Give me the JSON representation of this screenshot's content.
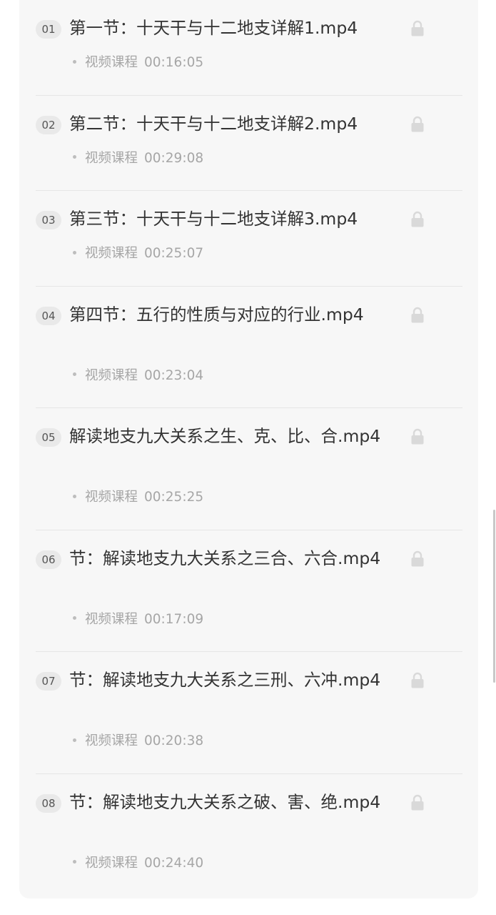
{
  "lessons": [
    {
      "index": "01",
      "title": "第一节：十天干与十二地支详解1.mp4",
      "type": "视频课程",
      "duration": "00:16:05",
      "locked": true
    },
    {
      "index": "02",
      "title": "第二节：十天干与十二地支详解2.mp4",
      "type": "视频课程",
      "duration": "00:29:08",
      "locked": true
    },
    {
      "index": "03",
      "title": "第三节：十天干与十二地支详解3.mp4",
      "type": "视频课程",
      "duration": "00:25:07",
      "locked": true
    },
    {
      "index": "04",
      "title": "第四节：五行的性质与对应的行业.mp4",
      "type": "视频课程",
      "duration": "00:23:04",
      "locked": true
    },
    {
      "index": "05",
      "title": "解读地支九大关系之生、克、比、合.mp4",
      "type": "视频课程",
      "duration": "00:25:25",
      "locked": true
    },
    {
      "index": "06",
      "title": "节：解读地支九大关系之三合、六合.mp4",
      "type": "视频课程",
      "duration": "00:17:09",
      "locked": true
    },
    {
      "index": "07",
      "title": "节：解读地支九大关系之三刑、六冲.mp4",
      "type": "视频课程",
      "duration": "00:20:38",
      "locked": true
    },
    {
      "index": "08",
      "title": "节：解读地支九大关系之破、害、绝.mp4",
      "type": "视频课程",
      "duration": "00:24:40",
      "locked": true
    }
  ],
  "colors": {
    "card_background": "#f7f7f7",
    "title_text": "#333333",
    "meta_text": "#a6a6a6",
    "badge_background": "#e9e9e9",
    "lock_icon": "#d9d9d9"
  },
  "icons": {
    "lock": "lock-icon",
    "bullet": "bullet-dot-icon"
  }
}
